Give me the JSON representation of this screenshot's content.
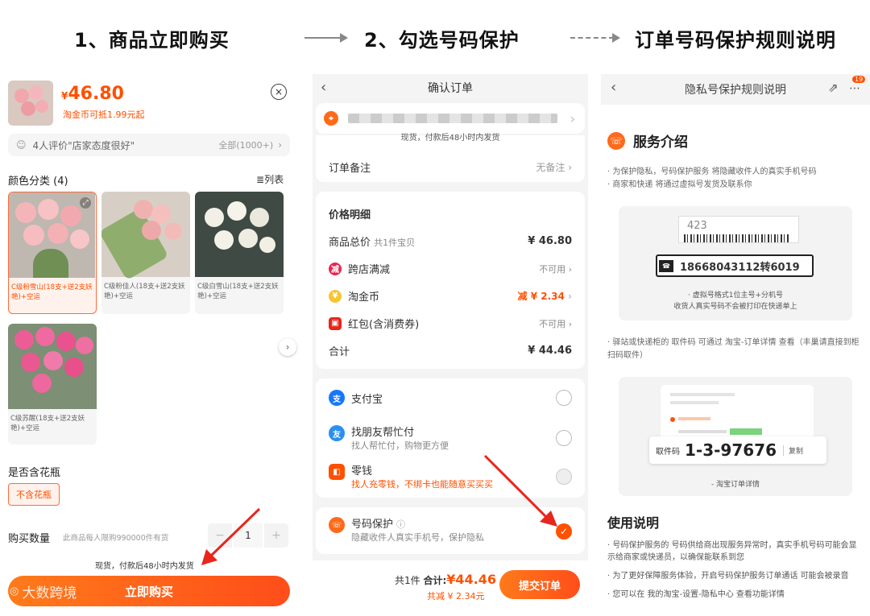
{
  "headers": {
    "step1": "1、商品立即购买",
    "step2": "2、勾选号码保护",
    "step3": "订单号码保护规则说明"
  },
  "colors": {
    "accent": "#ff5000",
    "orange_btn": "#ff6a1a",
    "arrow_red": "#e8261c"
  },
  "panel1": {
    "price_symbol": "¥",
    "price": "46.80",
    "coin_note": "淘金币可抵1.99元起",
    "review_text": "4人评价\"店家态度很好\"",
    "review_all": "全部(1000+)",
    "color_title": "颜色分类 (4)",
    "list_view": "列表",
    "variants": [
      {
        "label": "C级粉雪山(18支+送2支妖艳)+空运",
        "selected": true
      },
      {
        "label": "C级粉佳人(18支+送2支妖艳)+空运",
        "selected": false
      },
      {
        "label": "C级白雪山(18支+送2支妖艳)+空运",
        "selected": false
      },
      {
        "label": "C级苏醒(18支+送2支妖艳)+空运",
        "selected": false
      }
    ],
    "vase_title": "是否含花瓶",
    "vase_option": "不含花瓶",
    "qty_title": "购买数量",
    "qty_note": "此商品每人限购990000件有货",
    "qty_minus": "−",
    "qty_value": "1",
    "qty_plus": "+",
    "ship_note": "现货，付款后48小时内发货",
    "buy_button": "立即购买",
    "watermark": "大数跨境"
  },
  "panel2": {
    "title": "确认订单",
    "ship_note": "现货，付款后48小时内发货",
    "remark_label": "订单备注",
    "remark_value": "无备注",
    "detail_title": "价格明细",
    "total_label": "商品总价",
    "total_sub": "共1件宝贝",
    "total_value": "¥ 46.80",
    "cross_label": "跨店满减",
    "cross_value": "不可用",
    "coin_label": "淘金币",
    "coin_value": "减 ¥ 2.34",
    "redpack_label": "红包(含消费券)",
    "redpack_value": "不可用",
    "sum_label": "合计",
    "sum_value": "¥ 44.46",
    "pay_alipay": "支付宝",
    "pay_friend": "找朋友帮忙付",
    "pay_friend_sub": "找人帮忙付，购物更方便",
    "pay_change": "零钱",
    "pay_change_sub": "找人充零钱，不绑卡也能随意买买买",
    "protect_label": "号码保护",
    "protect_sub": "隐藏收件人真实手机号，保护隐私",
    "footer_count": "共1件",
    "footer_total_label": "合计:",
    "footer_total": "¥44.46",
    "footer_discount": "共减 ¥ 2.34元",
    "submit": "提交订单"
  },
  "panel3": {
    "title": "隐私号保护规则说明",
    "badge": "19",
    "service_title": "服务介绍",
    "bullet1": "· 为保护隐私，号码保护服务 将隐藏收件人的真实手机号码",
    "bullet2": "· 商家和快递 将通过虚拟号发货及联系你",
    "label_code": "423",
    "virtual_number": "18668043112转6019",
    "caption1": "· 虚拟号格式1位主号+分机号",
    "caption2": "收货人真实号码不会被打印在快递单上",
    "pickup_note": "· 驿站或快递柜的 取件码 可通过 淘宝-订单详情 查看（丰巢请直接到柜扫码取件）",
    "pickup_label": "取件码",
    "pickup_code": "1-3-97676",
    "copy": "复制",
    "order_detail": "淘宝订单详情",
    "usage_title": "使用说明",
    "usage1": "· 号码保护服务的 号码供给商出现服务异常时，真实手机号码可能会显示给商家或快递员，以确保能联系到您",
    "usage2": "· 为了更好保障服务体验，开启号码保护服务订单通话 可能会被录音",
    "usage3": "· 您可以在 我的淘宝-设置-隐私中心 查看功能详情"
  }
}
